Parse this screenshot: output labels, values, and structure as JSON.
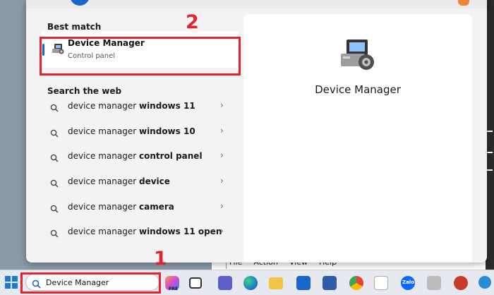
{
  "best_match": {
    "section_title": "Best match",
    "title": "Device Manager",
    "subtitle": "Control panel",
    "icon": "device-manager-icon"
  },
  "search_web": {
    "section_title": "Search the web",
    "items": [
      {
        "prefix": "device manager ",
        "bold": "windows 11"
      },
      {
        "prefix": "device manager ",
        "bold": "windows 10"
      },
      {
        "prefix": "device manager ",
        "bold": "control panel"
      },
      {
        "prefix": "device manager ",
        "bold": "device"
      },
      {
        "prefix": "device manager ",
        "bold": "camera"
      },
      {
        "prefix": "device manager ",
        "bold": "windows 11 open"
      }
    ]
  },
  "preview": {
    "title": "Device Manager"
  },
  "taskbar": {
    "search_value": "Device Manager",
    "icon_badge": "PRE",
    "zalo_label": "Zalo",
    "icons": [
      "copilot-icon",
      "task-view-icon",
      "teams-icon",
      "edge-icon",
      "file-explorer-icon",
      "mail-icon",
      "photo-app-icon",
      "chrome-icon",
      "store-icon",
      "zalo-icon",
      "cleanup-icon",
      "capture-icon",
      "update-icon"
    ]
  },
  "background_window": {
    "menu": [
      "File",
      "Action",
      "View",
      "Help"
    ]
  },
  "annotations": {
    "callout_1": "1",
    "callout_2": "2",
    "highlight_color": "#e0252f"
  }
}
